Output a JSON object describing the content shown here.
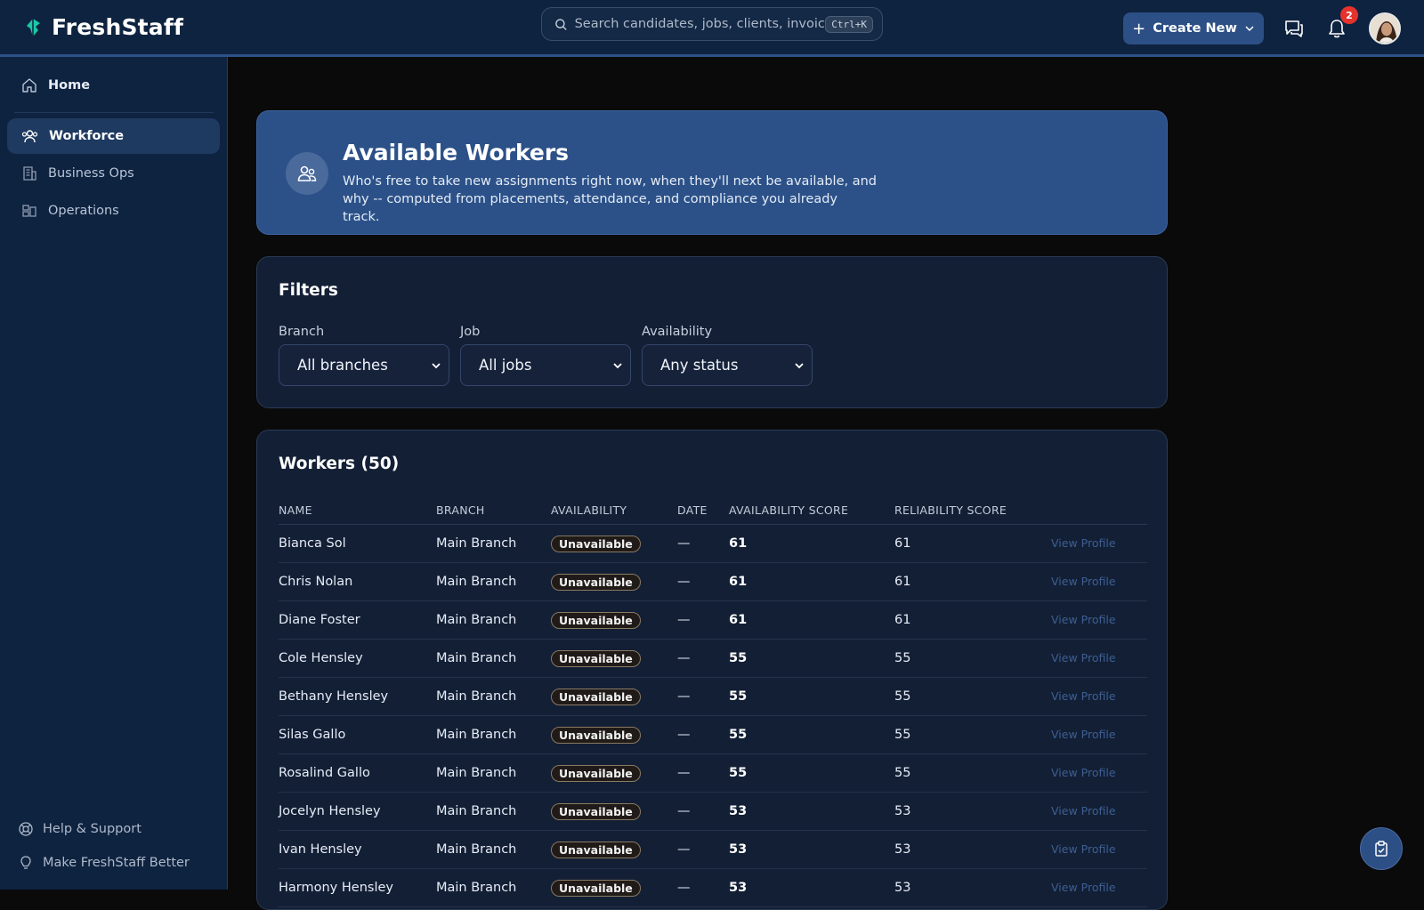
{
  "app": {
    "name": "FreshStaff"
  },
  "search": {
    "placeholder": "Search candidates, jobs, clients, invoices...",
    "shortcut": "Ctrl+K"
  },
  "header": {
    "create_label": "Create New",
    "notification_count": "2"
  },
  "sidebar": {
    "items": [
      {
        "label": "Home",
        "icon": "home-icon"
      },
      {
        "label": "Workforce",
        "icon": "people-icon",
        "active": true
      },
      {
        "label": "Business Ops",
        "icon": "building-icon"
      },
      {
        "label": "Operations",
        "icon": "layout-icon"
      }
    ],
    "footer": [
      {
        "label": "Help & Support",
        "icon": "lifebuoy-icon"
      },
      {
        "label": "Make FreshStaff Better",
        "icon": "lightbulb-icon"
      }
    ]
  },
  "hero": {
    "title": "Available Workers",
    "subtitle": "Who's free to take new assignments right now, when they'll next be available, and why -- computed from placements, attendance, and compliance you already track."
  },
  "filters": {
    "title": "Filters",
    "branch": {
      "label": "Branch",
      "value": "All branches"
    },
    "job": {
      "label": "Job",
      "value": "All jobs"
    },
    "availability": {
      "label": "Availability",
      "value": "Any status"
    }
  },
  "workers": {
    "title": "Workers (50)",
    "columns": [
      "NAME",
      "BRANCH",
      "AVAILABILITY",
      "DATE",
      "AVAILABILITY SCORE",
      "RELIABILITY SCORE",
      ""
    ],
    "action_label": "View Profile",
    "rows": [
      {
        "name": "Bianca Sol",
        "branch": "Main Branch",
        "availability": "Unavailable",
        "date": "—",
        "availability_score": "61",
        "reliability_score": "61"
      },
      {
        "name": "Chris Nolan",
        "branch": "Main Branch",
        "availability": "Unavailable",
        "date": "—",
        "availability_score": "61",
        "reliability_score": "61"
      },
      {
        "name": "Diane Foster",
        "branch": "Main Branch",
        "availability": "Unavailable",
        "date": "—",
        "availability_score": "61",
        "reliability_score": "61"
      },
      {
        "name": "Cole Hensley",
        "branch": "Main Branch",
        "availability": "Unavailable",
        "date": "—",
        "availability_score": "55",
        "reliability_score": "55"
      },
      {
        "name": "Bethany Hensley",
        "branch": "Main Branch",
        "availability": "Unavailable",
        "date": "—",
        "availability_score": "55",
        "reliability_score": "55"
      },
      {
        "name": "Silas Gallo",
        "branch": "Main Branch",
        "availability": "Unavailable",
        "date": "—",
        "availability_score": "55",
        "reliability_score": "55"
      },
      {
        "name": "Rosalind Gallo",
        "branch": "Main Branch",
        "availability": "Unavailable",
        "date": "—",
        "availability_score": "55",
        "reliability_score": "55"
      },
      {
        "name": "Jocelyn Hensley",
        "branch": "Main Branch",
        "availability": "Unavailable",
        "date": "—",
        "availability_score": "53",
        "reliability_score": "53"
      },
      {
        "name": "Ivan Hensley",
        "branch": "Main Branch",
        "availability": "Unavailable",
        "date": "—",
        "availability_score": "53",
        "reliability_score": "53"
      },
      {
        "name": "Harmony Hensley",
        "branch": "Main Branch",
        "availability": "Unavailable",
        "date": "—",
        "availability_score": "53",
        "reliability_score": "53"
      }
    ]
  },
  "colors": {
    "topbar": "#0e2340",
    "accent": "#2c4f85",
    "hero": "#2c5188",
    "brand_mark": "#1fc7a5",
    "notification": "#e5322d"
  }
}
